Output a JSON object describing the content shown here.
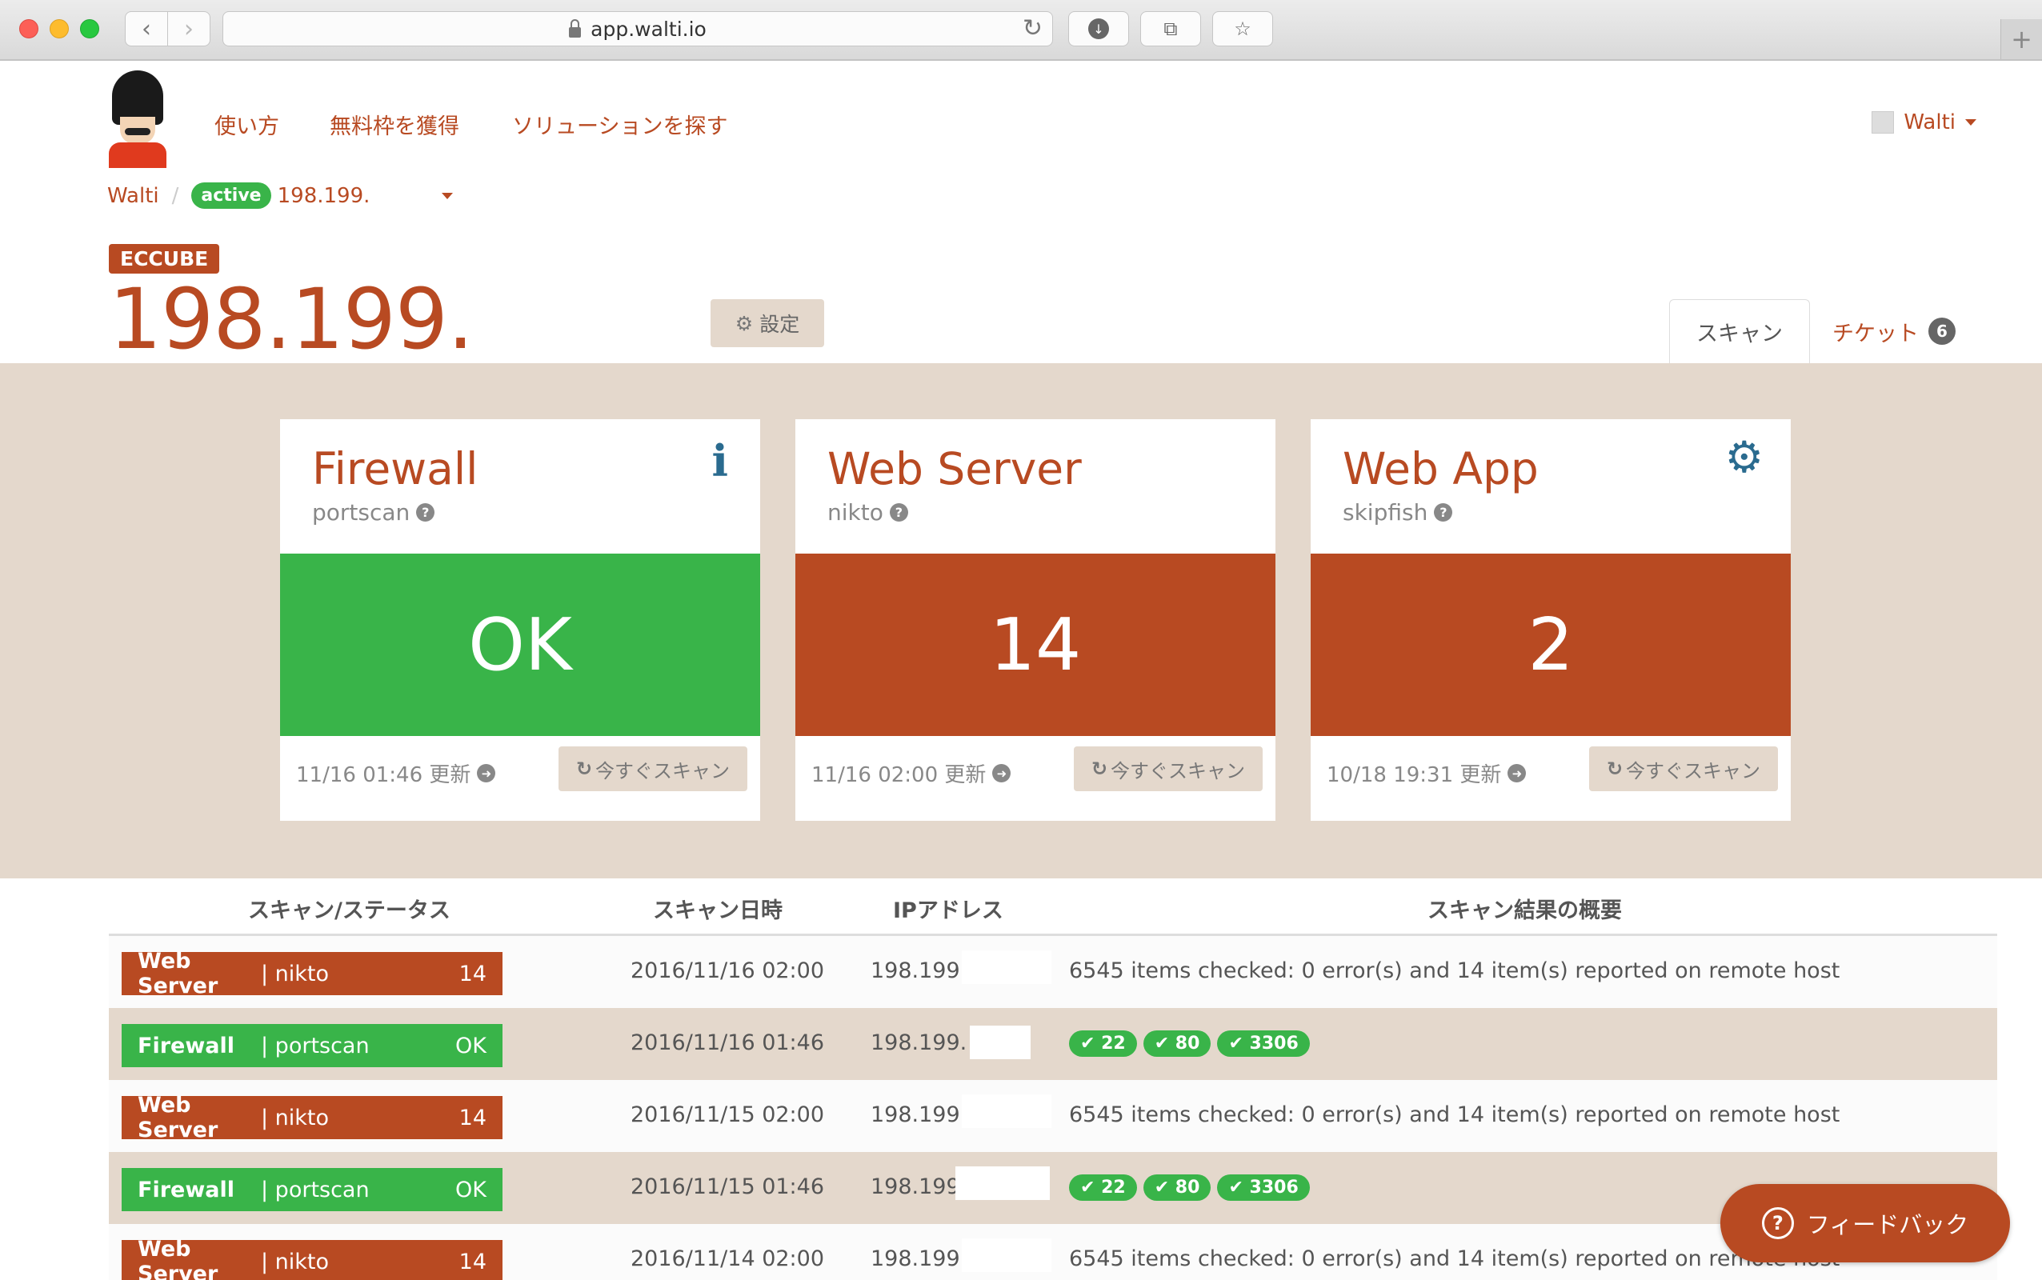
{
  "browser": {
    "url": "app.walti.io",
    "back_glyph": "‹",
    "forward_glyph": "›",
    "reload_glyph": "↻",
    "download_glyph": "↓",
    "tabs_glyph": "⧉",
    "bookmark_glyph": "☆",
    "newtab_glyph": "+"
  },
  "header": {
    "nav": [
      "使い方",
      "無料枠を獲得",
      "ソリューションを探す"
    ],
    "user": "Walti"
  },
  "breadcrumb": {
    "root": "Walti",
    "sep": "/",
    "status": "active",
    "host": "198.199."
  },
  "target": {
    "tag": "ECCUBE",
    "host": "198.199.",
    "settings_label": "設定",
    "settings_icon": "⚙"
  },
  "tabs": {
    "scan": "スキャン",
    "ticket": "チケット",
    "ticket_count": "6"
  },
  "cards": [
    {
      "title": "Firewall",
      "tool": "portscan",
      "status": "OK",
      "updated": "11/16 01:46 更新",
      "scan_now": "今すぐスキャン",
      "icon": "info-icon",
      "state": "ok"
    },
    {
      "title": "Web Server",
      "tool": "nikto",
      "status": "14",
      "updated": "11/16 02:00 更新",
      "scan_now": "今すぐスキャン",
      "icon": "",
      "state": "bad"
    },
    {
      "title": "Web App",
      "tool": "skipfish",
      "status": "2",
      "updated": "10/18 19:31 更新",
      "scan_now": "今すぐスキャン",
      "icon": "gears-icon",
      "state": "bad"
    }
  ],
  "icons": {
    "info": "i",
    "gears": "⚙",
    "question": "?",
    "arrow": "➜",
    "refresh": "↻",
    "check": "✔"
  },
  "table": {
    "headers": [
      "スキャン/ステータス",
      "スキャン日時",
      "IPアドレス",
      "スキャン結果の概要"
    ],
    "rows": [
      {
        "type": "Web Server",
        "tool": "| nikto",
        "value": "14",
        "date": "2016/11/16 02:00",
        "ip": "198.199.",
        "summary": "6545 items checked: 0 error(s) and 14 item(s) reported on remote host"
      },
      {
        "type": "Firewall",
        "tool": "| portscan",
        "value": "OK",
        "date": "2016/11/16 01:46",
        "ip": "198.199.",
        "ports": [
          "✔ 22",
          "✔ 80",
          "✔ 3306"
        ]
      },
      {
        "type": "Web Server",
        "tool": "| nikto",
        "value": "14",
        "date": "2016/11/15 02:00",
        "ip": "198.199.",
        "summary": "6545 items checked: 0 error(s) and 14 item(s) reported on remote host"
      },
      {
        "type": "Firewall",
        "tool": "| portscan",
        "value": "OK",
        "date": "2016/11/15 01:46",
        "ip": "198.199.",
        "ports": [
          "✔ 22",
          "✔ 80",
          "✔ 3306"
        ]
      },
      {
        "type": "Web Server",
        "tool": "| nikto",
        "value": "14",
        "date": "2016/11/14 02:00",
        "ip": "198.199.",
        "summary": "6545 items checked: 0 error(s) and 14 item(s) reported on remote host"
      }
    ]
  },
  "feedback": {
    "label": "フィードバック",
    "icon": "?"
  },
  "colors": {
    "brand": "#b84a22",
    "ok": "#39b449",
    "beige": "#e4d8cc"
  }
}
